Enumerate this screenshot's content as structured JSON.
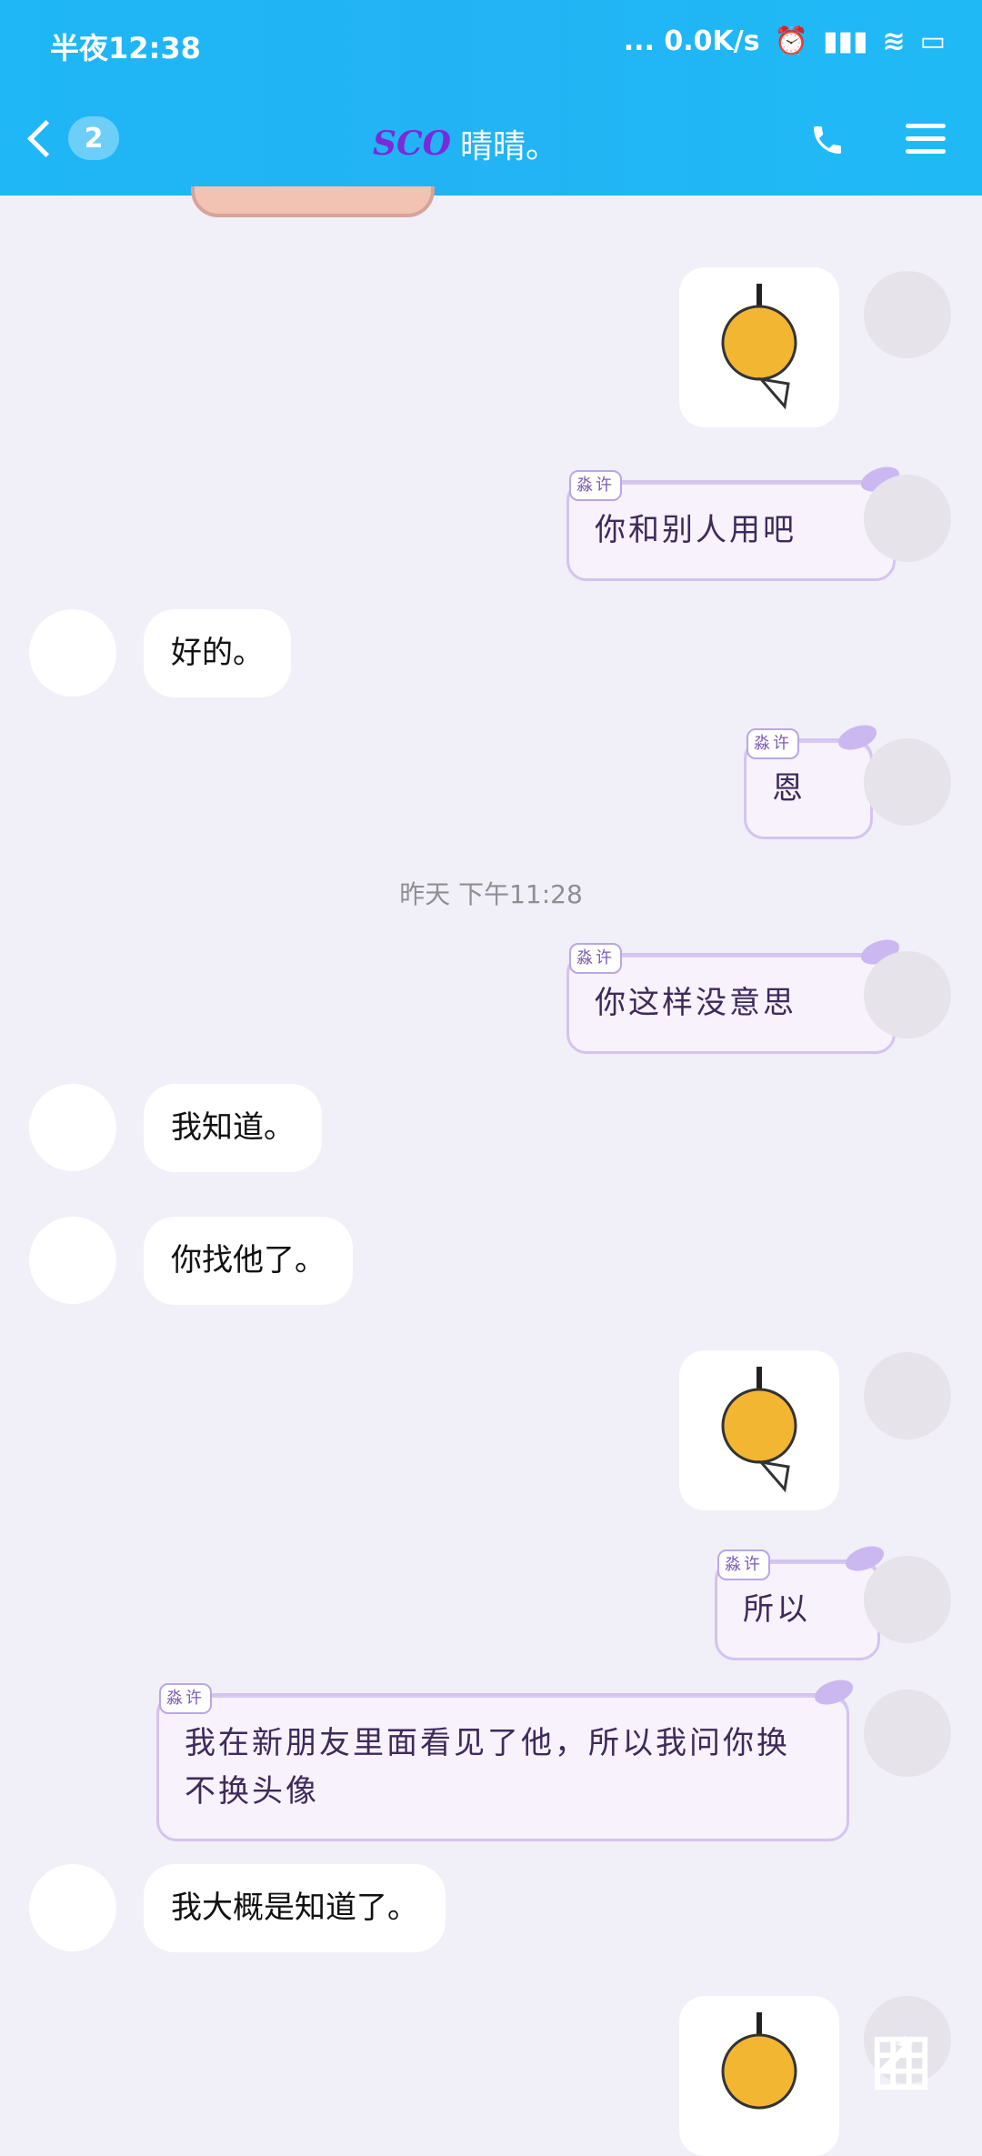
{
  "status_bar": {
    "time": "半夜12:38",
    "network": "... 0.0K/s"
  },
  "header": {
    "back_count": "2",
    "title_prefix": "SCO",
    "title": "晴晴。"
  },
  "messages": {
    "right_1": "你和别人用吧",
    "left_1": "好的。",
    "right_2": "恩",
    "timestamp": "昨天 下午11:28",
    "right_3": "你这样没意思",
    "left_2": "我知道。",
    "left_3": "你找他了。",
    "right_4": "所以",
    "right_5": "我在新朋友里面看见了他，所以我问你换不换头像",
    "left_4": "我大概是知道了。"
  },
  "bubble_tag": "淼许",
  "colors": {
    "topbar": "#1fb7f6",
    "background": "#f1eff7"
  }
}
